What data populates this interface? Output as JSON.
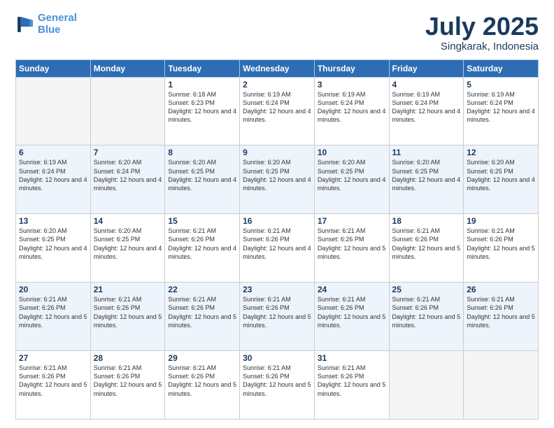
{
  "logo": {
    "line1": "General",
    "line2": "Blue"
  },
  "title": "July 2025",
  "subtitle": "Singkarak, Indonesia",
  "days_of_week": [
    "Sunday",
    "Monday",
    "Tuesday",
    "Wednesday",
    "Thursday",
    "Friday",
    "Saturday"
  ],
  "weeks": [
    [
      {
        "num": "",
        "info": ""
      },
      {
        "num": "",
        "info": ""
      },
      {
        "num": "1",
        "info": "Sunrise: 6:18 AM\nSunset: 6:23 PM\nDaylight: 12 hours and 4 minutes."
      },
      {
        "num": "2",
        "info": "Sunrise: 6:19 AM\nSunset: 6:24 PM\nDaylight: 12 hours and 4 minutes."
      },
      {
        "num": "3",
        "info": "Sunrise: 6:19 AM\nSunset: 6:24 PM\nDaylight: 12 hours and 4 minutes."
      },
      {
        "num": "4",
        "info": "Sunrise: 6:19 AM\nSunset: 6:24 PM\nDaylight: 12 hours and 4 minutes."
      },
      {
        "num": "5",
        "info": "Sunrise: 6:19 AM\nSunset: 6:24 PM\nDaylight: 12 hours and 4 minutes."
      }
    ],
    [
      {
        "num": "6",
        "info": "Sunrise: 6:19 AM\nSunset: 6:24 PM\nDaylight: 12 hours and 4 minutes."
      },
      {
        "num": "7",
        "info": "Sunrise: 6:20 AM\nSunset: 6:24 PM\nDaylight: 12 hours and 4 minutes."
      },
      {
        "num": "8",
        "info": "Sunrise: 6:20 AM\nSunset: 6:25 PM\nDaylight: 12 hours and 4 minutes."
      },
      {
        "num": "9",
        "info": "Sunrise: 6:20 AM\nSunset: 6:25 PM\nDaylight: 12 hours and 4 minutes."
      },
      {
        "num": "10",
        "info": "Sunrise: 6:20 AM\nSunset: 6:25 PM\nDaylight: 12 hours and 4 minutes."
      },
      {
        "num": "11",
        "info": "Sunrise: 6:20 AM\nSunset: 6:25 PM\nDaylight: 12 hours and 4 minutes."
      },
      {
        "num": "12",
        "info": "Sunrise: 6:20 AM\nSunset: 6:25 PM\nDaylight: 12 hours and 4 minutes."
      }
    ],
    [
      {
        "num": "13",
        "info": "Sunrise: 6:20 AM\nSunset: 6:25 PM\nDaylight: 12 hours and 4 minutes."
      },
      {
        "num": "14",
        "info": "Sunrise: 6:20 AM\nSunset: 6:25 PM\nDaylight: 12 hours and 4 minutes."
      },
      {
        "num": "15",
        "info": "Sunrise: 6:21 AM\nSunset: 6:26 PM\nDaylight: 12 hours and 4 minutes."
      },
      {
        "num": "16",
        "info": "Sunrise: 6:21 AM\nSunset: 6:26 PM\nDaylight: 12 hours and 4 minutes."
      },
      {
        "num": "17",
        "info": "Sunrise: 6:21 AM\nSunset: 6:26 PM\nDaylight: 12 hours and 5 minutes."
      },
      {
        "num": "18",
        "info": "Sunrise: 6:21 AM\nSunset: 6:26 PM\nDaylight: 12 hours and 5 minutes."
      },
      {
        "num": "19",
        "info": "Sunrise: 6:21 AM\nSunset: 6:26 PM\nDaylight: 12 hours and 5 minutes."
      }
    ],
    [
      {
        "num": "20",
        "info": "Sunrise: 6:21 AM\nSunset: 6:26 PM\nDaylight: 12 hours and 5 minutes."
      },
      {
        "num": "21",
        "info": "Sunrise: 6:21 AM\nSunset: 6:26 PM\nDaylight: 12 hours and 5 minutes."
      },
      {
        "num": "22",
        "info": "Sunrise: 6:21 AM\nSunset: 6:26 PM\nDaylight: 12 hours and 5 minutes."
      },
      {
        "num": "23",
        "info": "Sunrise: 6:21 AM\nSunset: 6:26 PM\nDaylight: 12 hours and 5 minutes."
      },
      {
        "num": "24",
        "info": "Sunrise: 6:21 AM\nSunset: 6:26 PM\nDaylight: 12 hours and 5 minutes."
      },
      {
        "num": "25",
        "info": "Sunrise: 6:21 AM\nSunset: 6:26 PM\nDaylight: 12 hours and 5 minutes."
      },
      {
        "num": "26",
        "info": "Sunrise: 6:21 AM\nSunset: 6:26 PM\nDaylight: 12 hours and 5 minutes."
      }
    ],
    [
      {
        "num": "27",
        "info": "Sunrise: 6:21 AM\nSunset: 6:26 PM\nDaylight: 12 hours and 5 minutes."
      },
      {
        "num": "28",
        "info": "Sunrise: 6:21 AM\nSunset: 6:26 PM\nDaylight: 12 hours and 5 minutes."
      },
      {
        "num": "29",
        "info": "Sunrise: 6:21 AM\nSunset: 6:26 PM\nDaylight: 12 hours and 5 minutes."
      },
      {
        "num": "30",
        "info": "Sunrise: 6:21 AM\nSunset: 6:26 PM\nDaylight: 12 hours and 5 minutes."
      },
      {
        "num": "31",
        "info": "Sunrise: 6:21 AM\nSunset: 6:26 PM\nDaylight: 12 hours and 5 minutes."
      },
      {
        "num": "",
        "info": ""
      },
      {
        "num": "",
        "info": ""
      }
    ]
  ],
  "colors": {
    "header_bg": "#2e6db4",
    "alt_row_bg": "#eef4fb",
    "empty_bg": "#f5f5f5",
    "title_color": "#1a3a5c"
  }
}
